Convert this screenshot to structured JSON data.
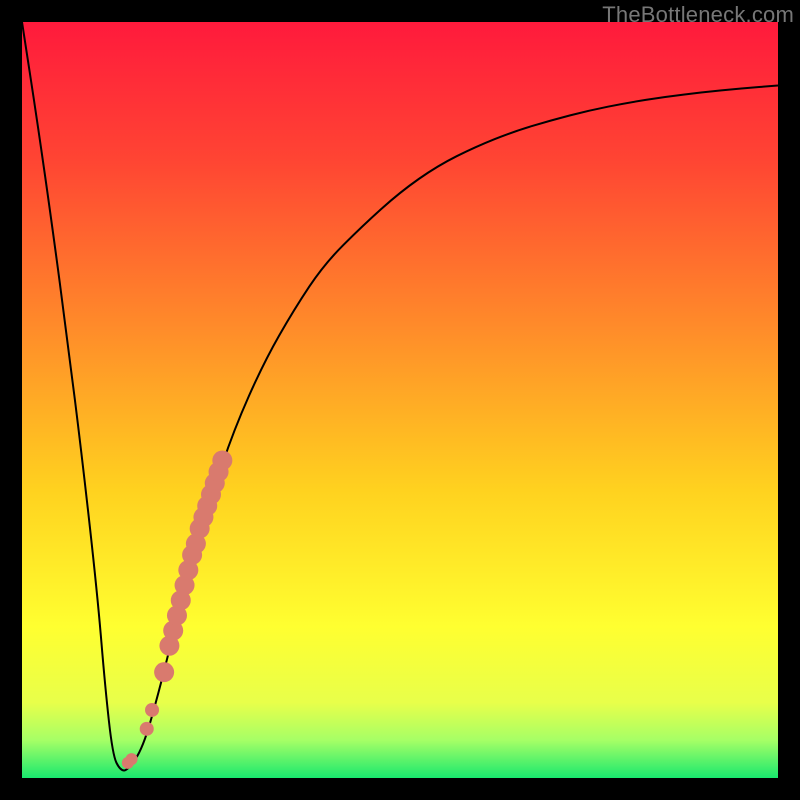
{
  "watermark": "TheBottleneck.com",
  "chart_data": {
    "type": "line",
    "title": "",
    "xlabel": "",
    "ylabel": "",
    "xlim": [
      0,
      100
    ],
    "ylim": [
      0,
      100
    ],
    "grid": false,
    "legend": false,
    "background_gradient": {
      "stops": [
        {
          "offset": 0.0,
          "color": "#ff1a3c"
        },
        {
          "offset": 0.18,
          "color": "#ff4433"
        },
        {
          "offset": 0.4,
          "color": "#ff8a2a"
        },
        {
          "offset": 0.62,
          "color": "#ffd21f"
        },
        {
          "offset": 0.8,
          "color": "#ffff30"
        },
        {
          "offset": 0.9,
          "color": "#e8ff4a"
        },
        {
          "offset": 0.95,
          "color": "#a6ff66"
        },
        {
          "offset": 1.0,
          "color": "#19e86e"
        }
      ]
    },
    "series": [
      {
        "name": "bottleneck-curve",
        "color": "#000000",
        "x": [
          0,
          2,
          4,
          6,
          8,
          10,
          11,
          12,
          13,
          14,
          16,
          18,
          20,
          22,
          25,
          28,
          32,
          36,
          40,
          45,
          50,
          55,
          60,
          65,
          70,
          75,
          80,
          85,
          90,
          95,
          100
        ],
        "y": [
          100,
          87,
          73,
          58,
          42,
          24,
          12,
          3,
          1,
          1,
          4,
          11,
          19,
          27,
          37,
          46,
          55,
          62,
          68,
          73,
          77.5,
          81,
          83.5,
          85.5,
          87,
          88.3,
          89.3,
          90.1,
          90.7,
          91.2,
          91.6
        ]
      }
    ],
    "highlight_points": {
      "name": "highlight-strip",
      "color": "#d97a6e",
      "points": [
        {
          "x": 14.0,
          "y": 2.0
        },
        {
          "x": 14.5,
          "y": 2.5
        },
        {
          "x": 16.5,
          "y": 6.5
        },
        {
          "x": 17.2,
          "y": 9.0
        },
        {
          "x": 18.8,
          "y": 14.0
        },
        {
          "x": 19.5,
          "y": 17.5
        },
        {
          "x": 20.0,
          "y": 19.5
        },
        {
          "x": 20.5,
          "y": 21.5
        },
        {
          "x": 21.0,
          "y": 23.5
        },
        {
          "x": 21.5,
          "y": 25.5
        },
        {
          "x": 22.0,
          "y": 27.5
        },
        {
          "x": 22.5,
          "y": 29.5
        },
        {
          "x": 23.0,
          "y": 31.0
        },
        {
          "x": 23.5,
          "y": 33.0
        },
        {
          "x": 24.0,
          "y": 34.5
        },
        {
          "x": 24.5,
          "y": 36.0
        },
        {
          "x": 25.0,
          "y": 37.5
        },
        {
          "x": 25.5,
          "y": 39.0
        },
        {
          "x": 26.0,
          "y": 40.5
        },
        {
          "x": 26.5,
          "y": 42.0
        }
      ]
    }
  }
}
